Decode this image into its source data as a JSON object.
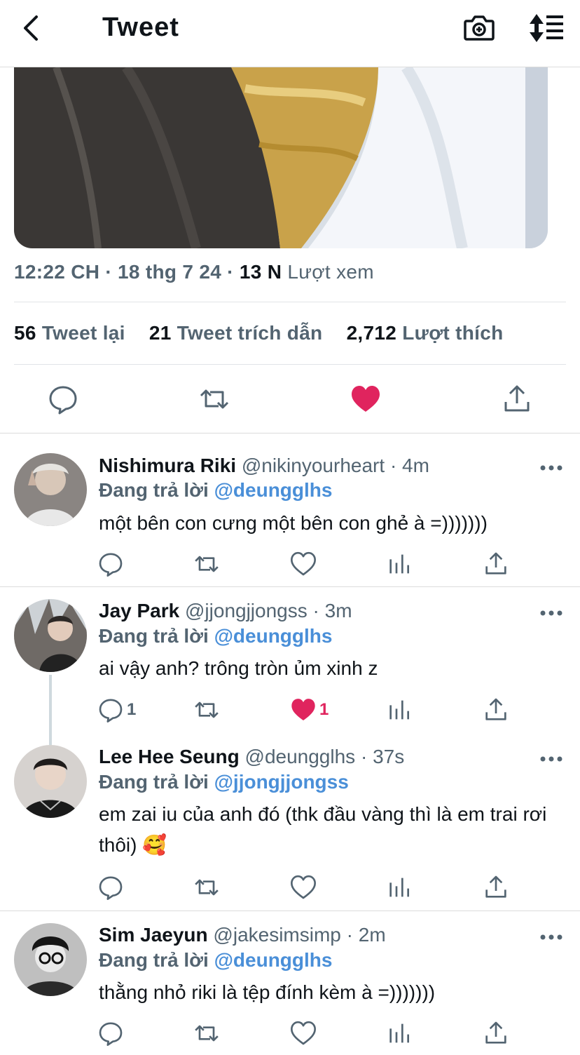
{
  "header": {
    "title": "Tweet",
    "back_icon": "chevron-left-icon",
    "camera_icon": "camera-icon",
    "sort_icon": "sort-icon"
  },
  "tweet": {
    "time": "12:22 CH",
    "date": "18 thg 7 24",
    "views_count": "13 N",
    "views_label": "Lượt xem",
    "retweets_count": "56",
    "retweets_label": "Tweet lại",
    "quotes_count": "21",
    "quotes_label": "Tweet trích dẫn",
    "likes_count": "2,712",
    "likes_label": "Lượt thích",
    "liked": true
  },
  "colors": {
    "like_red": "#e0245e",
    "mention_blue": "#4a8fd8",
    "secondary": "#536471"
  },
  "replies": [
    {
      "name": "Nishimura Riki",
      "handle": "@nikinyourheart",
      "time": "4m",
      "replying_label": "Đang trả lời",
      "replying_to": "@deungglhs",
      "text": "một bên con cưng một bên con ghẻ à =)))))))",
      "reply_count": "",
      "like_count": "",
      "liked": false
    },
    {
      "name": "Jay Park",
      "handle": "@jjongjjongss",
      "time": "3m",
      "replying_label": "Đang trả lời",
      "replying_to": "@deungglhs",
      "text": "ai vậy anh? trông tròn ủm xinh z",
      "reply_count": "1",
      "like_count": "1",
      "liked": true
    },
    {
      "name": "Lee Hee Seung",
      "handle": "@deungglhs",
      "time": "37s",
      "replying_label": "Đang trả lời",
      "replying_to": "@jjongjjongss",
      "text": "em zai iu của anh đó (thk đầu vàng thì là em trai rơi thôi) 🥰",
      "reply_count": "",
      "like_count": "",
      "liked": false
    },
    {
      "name": "Sim Jaeyun",
      "handle": "@jakesimsimp",
      "time": "2m",
      "replying_label": "Đang trả lời",
      "replying_to": "@deungglhs",
      "text": "thằng nhỏ riki là tệp đính kèm à =)))))))",
      "reply_count": "",
      "like_count": "",
      "liked": false
    }
  ]
}
